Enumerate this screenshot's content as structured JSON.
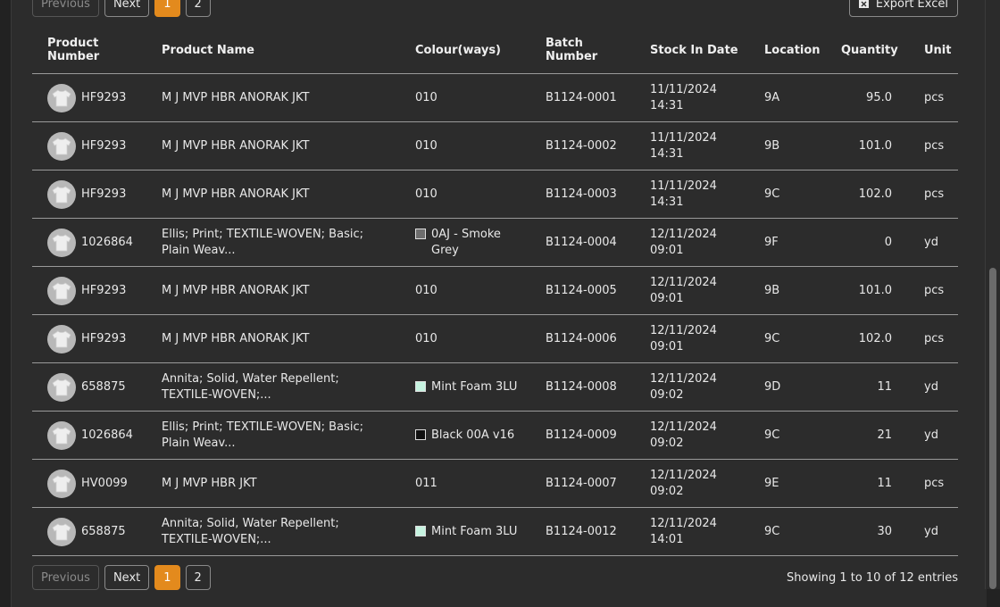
{
  "pagination": {
    "previous_label": "Previous",
    "next_label": "Next",
    "pages": [
      "1",
      "2"
    ],
    "active_page": "1"
  },
  "toolbar": {
    "export_label": "Export Excel",
    "export_icon": "excel-file-icon"
  },
  "table": {
    "headers": {
      "product_number": "Product Number",
      "product_name": "Product Name",
      "colourways": "Colour(ways)",
      "batch_number": "Batch Number",
      "stock_in_date": "Stock In Date",
      "location": "Location",
      "quantity": "Quantity",
      "unit": "Unit"
    },
    "rows": [
      {
        "product_number": "HF9293",
        "product_name": "M J MVP HBR ANORAK JKT",
        "colour": "010",
        "swatch": "",
        "batch": "B1124-0001",
        "date": "11/11/2024 14:31",
        "location": "9A",
        "quantity": "95.0",
        "unit": "pcs"
      },
      {
        "product_number": "HF9293",
        "product_name": "M J MVP HBR ANORAK JKT",
        "colour": "010",
        "swatch": "",
        "batch": "B1124-0002",
        "date": "11/11/2024 14:31",
        "location": "9B",
        "quantity": "101.0",
        "unit": "pcs"
      },
      {
        "product_number": "HF9293",
        "product_name": "M J MVP HBR ANORAK JKT",
        "colour": "010",
        "swatch": "",
        "batch": "B1124-0003",
        "date": "11/11/2024 14:31",
        "location": "9C",
        "quantity": "102.0",
        "unit": "pcs"
      },
      {
        "product_number": "1026864",
        "product_name": "Ellis; Print; TEXTILE-WOVEN; Basic; Plain Weav...",
        "colour": "0AJ - Smoke Grey",
        "swatch": "#6d6d6d",
        "batch": "B1124-0004",
        "date": "12/11/2024 09:01",
        "location": "9F",
        "quantity": "0",
        "unit": "yd"
      },
      {
        "product_number": "HF9293",
        "product_name": "M J MVP HBR ANORAK JKT",
        "colour": "010",
        "swatch": "",
        "batch": "B1124-0005",
        "date": "12/11/2024 09:01",
        "location": "9B",
        "quantity": "101.0",
        "unit": "pcs"
      },
      {
        "product_number": "HF9293",
        "product_name": "M J MVP HBR ANORAK JKT",
        "colour": "010",
        "swatch": "",
        "batch": "B1124-0006",
        "date": "12/11/2024 09:01",
        "location": "9C",
        "quantity": "102.0",
        "unit": "pcs"
      },
      {
        "product_number": "658875",
        "product_name": "Annita; Solid, Water Repellent; TEXTILE-WOVEN;...",
        "colour": "Mint Foam 3LU",
        "swatch": "#c6f3e0",
        "batch": "B1124-0008",
        "date": "12/11/2024 09:02",
        "location": "9D",
        "quantity": "11",
        "unit": "yd"
      },
      {
        "product_number": "1026864",
        "product_name": "Ellis; Print; TEXTILE-WOVEN; Basic; Plain Weav...",
        "colour": "Black 00A v16",
        "swatch": "#111111",
        "batch": "B1124-0009",
        "date": "12/11/2024 09:02",
        "location": "9C",
        "quantity": "21",
        "unit": "yd"
      },
      {
        "product_number": "HV0099",
        "product_name": "M J MVP HBR JKT",
        "colour": "011",
        "swatch": "",
        "batch": "B1124-0007",
        "date": "12/11/2024 09:02",
        "location": "9E",
        "quantity": "11",
        "unit": "pcs"
      },
      {
        "product_number": "658875",
        "product_name": "Annita; Solid, Water Repellent; TEXTILE-WOVEN;...",
        "colour": "Mint Foam 3LU",
        "swatch": "#c6f3e0",
        "batch": "B1124-0012",
        "date": "12/11/2024 14:01",
        "location": "9C",
        "quantity": "30",
        "unit": "yd"
      }
    ]
  },
  "footer": {
    "showing_text": "Showing 1 to 10 of 12 entries"
  },
  "colors": {
    "accent": "#e38a1d",
    "background": "#2c2c2c"
  }
}
